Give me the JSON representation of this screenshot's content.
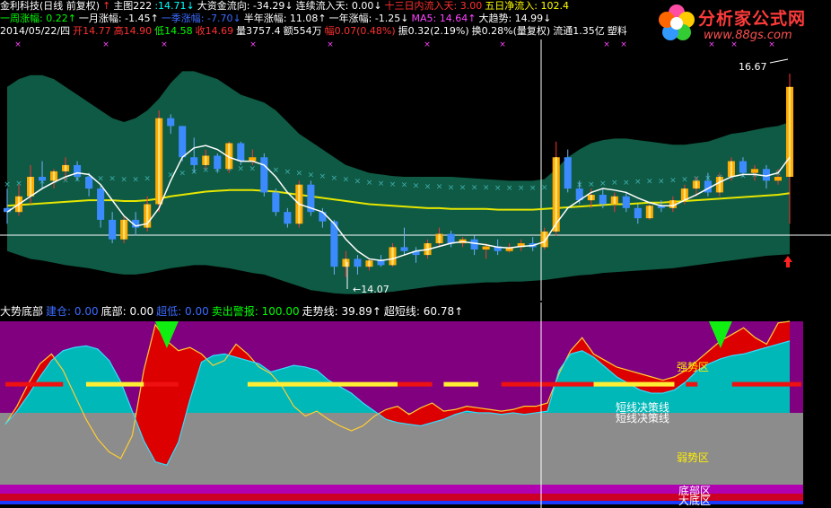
{
  "header": {
    "row1": [
      {
        "text": "金利科技(日线 前复权)",
        "color": "#ffffff"
      },
      {
        "text": "↑",
        "color": "#ff3030"
      },
      {
        "text": "主图222",
        "color": "#ffffff"
      },
      {
        "text": ":14.71↓",
        "color": "#00ffff"
      },
      {
        "text": "大资金流向: -34.29↓",
        "color": "#ffffff"
      },
      {
        "text": "连续流入天: 0.00↓",
        "color": "#ffffff"
      },
      {
        "text": "十三日内流入天: 3.00",
        "color": "#ff3030"
      },
      {
        "text": "五日净流入: 102.4",
        "color": "#ffff00"
      }
    ],
    "row2": [
      {
        "text": "一周涨幅: 0.22↑",
        "color": "#00ff00"
      },
      {
        "text": "一月涨幅: -1.45↑",
        "color": "#ffffff"
      },
      {
        "text": "一季涨幅: -7.70↓",
        "color": "#3b6bff"
      },
      {
        "text": "半年涨幅: 11.08↑",
        "color": "#ffffff"
      },
      {
        "text": "一年涨幅: -1.25↓",
        "color": "#ffffff"
      },
      {
        "text": "MA5: 14.64↑",
        "color": "#ff44ff"
      },
      {
        "text": "大趋势: 14.99↓",
        "color": "#ffffff"
      }
    ],
    "row3": [
      {
        "text": "2014/05/22/四",
        "color": "#ffffff"
      },
      {
        "text": "开14.77",
        "color": "#ff3030"
      },
      {
        "text": "高14.90",
        "color": "#ff3030"
      },
      {
        "text": "低14.58",
        "color": "#00ff00"
      },
      {
        "text": "收14.69",
        "color": "#ff3030"
      },
      {
        "text": "量3757.4",
        "color": "#ffffff"
      },
      {
        "text": "额554万",
        "color": "#ffffff"
      },
      {
        "text": "幅0.07(0.48%)",
        "color": "#ff3030"
      },
      {
        "text": "振0.32(2.19%)",
        "color": "#ffffff"
      },
      {
        "text": "换0.28%(量复权)",
        "color": "#ffffff"
      },
      {
        "text": "流通1.35亿",
        "color": "#ffffff"
      },
      {
        "text": "塑料",
        "color": "#ffffff"
      }
    ]
  },
  "logo": {
    "title": "分析家公式网",
    "url": "www.88gs.com"
  },
  "lower_header": [
    {
      "text": "大势底部",
      "color": "#ffffff"
    },
    {
      "text": "建仓: 0.00",
      "color": "#3b6bff"
    },
    {
      "text": "底部: 0.00",
      "color": "#ffffff"
    },
    {
      "text": "超低: 0.00",
      "color": "#3b6bff"
    },
    {
      "text": "卖出警报: 100.00",
      "color": "#00ff00"
    },
    {
      "text": "走势线: 39.89↑",
      "color": "#ffffff"
    },
    {
      "text": "超短线: 60.78↑",
      "color": "#ffffff"
    }
  ],
  "colors": {
    "band": "#0f5a44",
    "up": "#ffaa00",
    "down": "#3b8bff",
    "ma_white": "#ffffff",
    "ma_yellow": "#e6e600",
    "marker": "#3fb0b0",
    "purple": "#800080",
    "cyan": "#00b8b8",
    "gray": "#8c8c8c",
    "red": "#dd0000"
  },
  "chart_data": [
    {
      "type": "candlestick",
      "price_labels": {
        "high_label": "16.67",
        "low_label": "14.07"
      },
      "ylim": [
        13.8,
        16.9
      ],
      "candles": [
        {
          "o": 14.95,
          "h": 15.2,
          "l": 14.75,
          "c": 14.9
        },
        {
          "o": 14.9,
          "h": 15.25,
          "l": 14.85,
          "c": 15.1
        },
        {
          "o": 15.1,
          "h": 15.5,
          "l": 15.0,
          "c": 15.35
        },
        {
          "o": 15.35,
          "h": 15.55,
          "l": 15.2,
          "c": 15.3
        },
        {
          "o": 15.3,
          "h": 15.45,
          "l": 15.2,
          "c": 15.42
        },
        {
          "o": 15.42,
          "h": 15.6,
          "l": 15.3,
          "c": 15.5
        },
        {
          "o": 15.5,
          "h": 15.55,
          "l": 15.3,
          "c": 15.35
        },
        {
          "o": 15.35,
          "h": 15.4,
          "l": 15.1,
          "c": 15.2
        },
        {
          "o": 15.2,
          "h": 15.25,
          "l": 14.7,
          "c": 14.8
        },
        {
          "o": 14.8,
          "h": 14.9,
          "l": 14.5,
          "c": 14.55
        },
        {
          "o": 14.55,
          "h": 14.85,
          "l": 14.5,
          "c": 14.8
        },
        {
          "o": 14.8,
          "h": 14.9,
          "l": 14.6,
          "c": 14.7
        },
        {
          "o": 14.7,
          "h": 15.1,
          "l": 14.65,
          "c": 15.0
        },
        {
          "o": 15.0,
          "h": 16.2,
          "l": 14.9,
          "c": 16.1
        },
        {
          "o": 16.1,
          "h": 16.15,
          "l": 15.9,
          "c": 16.0
        },
        {
          "o": 16.0,
          "h": 16.0,
          "l": 15.55,
          "c": 15.6
        },
        {
          "o": 15.6,
          "h": 15.85,
          "l": 15.4,
          "c": 15.5
        },
        {
          "o": 15.5,
          "h": 15.7,
          "l": 15.45,
          "c": 15.62
        },
        {
          "o": 15.62,
          "h": 15.65,
          "l": 15.4,
          "c": 15.45
        },
        {
          "o": 15.45,
          "h": 15.8,
          "l": 15.4,
          "c": 15.78
        },
        {
          "o": 15.78,
          "h": 15.8,
          "l": 15.5,
          "c": 15.55
        },
        {
          "o": 15.55,
          "h": 15.7,
          "l": 15.5,
          "c": 15.6
        },
        {
          "o": 15.6,
          "h": 15.65,
          "l": 15.1,
          "c": 15.15
        },
        {
          "o": 15.15,
          "h": 15.2,
          "l": 14.85,
          "c": 14.9
        },
        {
          "o": 14.9,
          "h": 14.95,
          "l": 14.7,
          "c": 14.75
        },
        {
          "o": 14.75,
          "h": 15.3,
          "l": 14.7,
          "c": 15.25
        },
        {
          "o": 15.25,
          "h": 15.3,
          "l": 14.85,
          "c": 14.9
        },
        {
          "o": 14.9,
          "h": 14.95,
          "l": 14.7,
          "c": 14.78
        },
        {
          "o": 14.78,
          "h": 14.8,
          "l": 14.1,
          "c": 14.2
        },
        {
          "o": 14.2,
          "h": 14.4,
          "l": 14.07,
          "c": 14.3
        },
        {
          "o": 14.3,
          "h": 14.35,
          "l": 14.1,
          "c": 14.2
        },
        {
          "o": 14.2,
          "h": 14.3,
          "l": 14.15,
          "c": 14.28
        },
        {
          "o": 14.28,
          "h": 14.35,
          "l": 14.2,
          "c": 14.22
        },
        {
          "o": 14.22,
          "h": 14.5,
          "l": 14.2,
          "c": 14.45
        },
        {
          "o": 14.45,
          "h": 14.7,
          "l": 14.35,
          "c": 14.4
        },
        {
          "o": 14.4,
          "h": 14.45,
          "l": 14.25,
          "c": 14.35
        },
        {
          "o": 14.35,
          "h": 14.55,
          "l": 14.3,
          "c": 14.5
        },
        {
          "o": 14.5,
          "h": 14.7,
          "l": 14.45,
          "c": 14.62
        },
        {
          "o": 14.62,
          "h": 14.66,
          "l": 14.45,
          "c": 14.5
        },
        {
          "o": 14.5,
          "h": 14.58,
          "l": 14.45,
          "c": 14.55
        },
        {
          "o": 14.55,
          "h": 14.6,
          "l": 14.35,
          "c": 14.42
        },
        {
          "o": 14.42,
          "h": 14.5,
          "l": 14.3,
          "c": 14.46
        },
        {
          "o": 14.46,
          "h": 14.55,
          "l": 14.35,
          "c": 14.4
        },
        {
          "o": 14.4,
          "h": 14.5,
          "l": 14.38,
          "c": 14.45
        },
        {
          "o": 14.45,
          "h": 14.55,
          "l": 14.4,
          "c": 14.5
        },
        {
          "o": 14.5,
          "h": 14.58,
          "l": 14.4,
          "c": 14.45
        },
        {
          "o": 14.45,
          "h": 14.7,
          "l": 14.42,
          "c": 14.65
        },
        {
          "o": 14.65,
          "h": 15.8,
          "l": 14.6,
          "c": 15.6
        },
        {
          "o": 15.6,
          "h": 15.7,
          "l": 15.15,
          "c": 15.2
        },
        {
          "o": 15.2,
          "h": 15.3,
          "l": 15.0,
          "c": 15.05
        },
        {
          "o": 15.05,
          "h": 15.2,
          "l": 14.95,
          "c": 15.12
        },
        {
          "o": 15.12,
          "h": 15.2,
          "l": 14.95,
          "c": 15.0
        },
        {
          "o": 15.0,
          "h": 15.15,
          "l": 14.9,
          "c": 15.1
        },
        {
          "o": 15.1,
          "h": 15.15,
          "l": 14.9,
          "c": 14.95
        },
        {
          "o": 14.95,
          "h": 15.0,
          "l": 14.75,
          "c": 14.82
        },
        {
          "o": 14.82,
          "h": 15.0,
          "l": 14.8,
          "c": 14.98
        },
        {
          "o": 14.98,
          "h": 15.05,
          "l": 14.9,
          "c": 14.95
        },
        {
          "o": 14.95,
          "h": 15.1,
          "l": 14.9,
          "c": 15.05
        },
        {
          "o": 15.05,
          "h": 15.25,
          "l": 15.0,
          "c": 15.2
        },
        {
          "o": 15.2,
          "h": 15.35,
          "l": 15.1,
          "c": 15.3
        },
        {
          "o": 15.3,
          "h": 15.4,
          "l": 15.1,
          "c": 15.15
        },
        {
          "o": 15.15,
          "h": 15.4,
          "l": 15.1,
          "c": 15.35
        },
        {
          "o": 15.35,
          "h": 15.6,
          "l": 15.3,
          "c": 15.55
        },
        {
          "o": 15.55,
          "h": 15.6,
          "l": 15.35,
          "c": 15.4
        },
        {
          "o": 15.4,
          "h": 15.5,
          "l": 15.3,
          "c": 15.45
        },
        {
          "o": 15.45,
          "h": 15.5,
          "l": 15.2,
          "c": 15.3
        },
        {
          "o": 15.3,
          "h": 15.45,
          "l": 15.25,
          "c": 15.35
        },
        {
          "o": 15.35,
          "h": 16.67,
          "l": 14.75,
          "c": 16.5
        }
      ],
      "ma_white": [
        14.9,
        15.0,
        15.1,
        15.2,
        15.28,
        15.35,
        15.4,
        15.38,
        15.25,
        15.05,
        14.85,
        14.72,
        14.75,
        14.95,
        15.3,
        15.6,
        15.72,
        15.75,
        15.7,
        15.6,
        15.55,
        15.55,
        15.5,
        15.35,
        15.15,
        15.0,
        14.95,
        14.9,
        14.75,
        14.55,
        14.4,
        14.3,
        14.28,
        14.3,
        14.35,
        14.4,
        14.42,
        14.46,
        14.5,
        14.52,
        14.5,
        14.48,
        14.45,
        14.44,
        14.46,
        14.47,
        14.52,
        14.75,
        14.95,
        15.05,
        15.15,
        15.2,
        15.18,
        15.15,
        15.08,
        15.02,
        14.98,
        14.98,
        15.05,
        15.12,
        15.2,
        15.28,
        15.35,
        15.38,
        15.38,
        15.36,
        15.4,
        15.6
      ],
      "ma_yellow": [
        14.98,
        14.99,
        15.0,
        15.01,
        15.02,
        15.03,
        15.04,
        15.05,
        15.05,
        15.05,
        15.04,
        15.04,
        15.05,
        15.07,
        15.1,
        15.12,
        15.14,
        15.16,
        15.17,
        15.18,
        15.18,
        15.18,
        15.17,
        15.16,
        15.14,
        15.12,
        15.1,
        15.08,
        15.06,
        15.04,
        15.02,
        15.0,
        14.99,
        14.98,
        14.97,
        14.96,
        14.95,
        14.95,
        14.94,
        14.94,
        14.94,
        14.94,
        14.93,
        14.93,
        14.93,
        14.93,
        14.94,
        14.95,
        14.96,
        14.97,
        14.98,
        14.99,
        15.0,
        15.0,
        15.01,
        15.02,
        15.02,
        15.03,
        15.04,
        15.05,
        15.06,
        15.07,
        15.08,
        15.09,
        15.1,
        15.11,
        15.12,
        15.14
      ],
      "band_upper": [
        16.5,
        16.6,
        16.65,
        16.65,
        16.6,
        16.5,
        16.4,
        16.3,
        16.2,
        16.1,
        16.05,
        16.1,
        16.2,
        16.35,
        16.55,
        16.7,
        16.7,
        16.65,
        16.6,
        16.5,
        16.4,
        16.35,
        16.3,
        16.2,
        16.05,
        15.9,
        15.8,
        15.7,
        15.6,
        15.5,
        15.45,
        15.4,
        15.38,
        15.36,
        15.35,
        15.35,
        15.35,
        15.35,
        15.35,
        15.34,
        15.33,
        15.32,
        15.31,
        15.3,
        15.3,
        15.3,
        15.32,
        15.45,
        15.6,
        15.7,
        15.78,
        15.82,
        15.84,
        15.84,
        15.82,
        15.8,
        15.78,
        15.76,
        15.76,
        15.78,
        15.8,
        15.85,
        15.9,
        15.92,
        15.95,
        15.98,
        16.0,
        16.05
      ],
      "band_lower": [
        14.4,
        14.35,
        14.3,
        14.28,
        14.25,
        14.22,
        14.2,
        14.18,
        14.15,
        14.12,
        14.1,
        14.1,
        14.12,
        14.15,
        14.18,
        14.2,
        14.22,
        14.22,
        14.2,
        14.18,
        14.15,
        14.12,
        14.1,
        14.05,
        14.0,
        13.95,
        13.9,
        13.88,
        13.86,
        13.85,
        13.85,
        13.86,
        13.87,
        13.88,
        13.9,
        13.92,
        13.94,
        13.96,
        13.97,
        13.98,
        13.99,
        14.0,
        14.0,
        14.01,
        14.01,
        14.02,
        14.03,
        14.05,
        14.07,
        14.09,
        14.1,
        14.12,
        14.13,
        14.14,
        14.15,
        14.16,
        14.17,
        14.18,
        14.2,
        14.22,
        14.24,
        14.26,
        14.28,
        14.3,
        14.32,
        14.34,
        14.35,
        14.36
      ]
    },
    {
      "type": "area",
      "title": "大势底部",
      "ylim": [
        0,
        100
      ],
      "zone_labels": {
        "strong": "强势区",
        "short": "短线决策线",
        "weak": "弱势区",
        "bottom": "底部区",
        "big_bottom": "大底区"
      },
      "cyan_area": [
        37,
        45,
        55,
        66,
        76,
        82,
        84,
        85,
        83,
        76,
        63,
        45,
        27,
        14,
        12,
        26,
        52,
        75,
        79,
        80,
        78,
        76,
        74,
        69,
        71,
        73,
        72,
        70,
        64,
        60,
        56,
        50,
        45,
        40,
        38,
        37,
        36,
        38,
        40,
        43,
        45,
        44,
        44,
        43,
        44,
        43,
        44,
        45,
        70,
        80,
        82,
        78,
        72,
        66,
        62,
        58,
        56,
        56,
        58,
        63,
        70,
        74,
        77,
        79,
        80,
        82,
        84,
        86,
        88
      ],
      "red_line": [
        37,
        48,
        62,
        74,
        80,
        70,
        55,
        40,
        28,
        20,
        16,
        30,
        70,
        98,
        88,
        82,
        84,
        80,
        73,
        76,
        86,
        80,
        72,
        68,
        60,
        48,
        42,
        45,
        40,
        36,
        33,
        36,
        42,
        46,
        48,
        43,
        47,
        50,
        45,
        46,
        48,
        47,
        46,
        45,
        46,
        48,
        48,
        50,
        68,
        82,
        90,
        80,
        76,
        72,
        70,
        68,
        66,
        64,
        66,
        70,
        76,
        82,
        88,
        92,
        96,
        90,
        86,
        99,
        100
      ],
      "red_segments": [
        {
          "from": 0,
          "to": 5,
          "level": 62
        },
        {
          "from": 12,
          "to": 15,
          "level": 62
        },
        {
          "from": 34,
          "to": 37,
          "level": 62
        },
        {
          "from": 43,
          "to": 51,
          "level": 62
        },
        {
          "from": 59,
          "to": 60,
          "level": 62
        },
        {
          "from": 63,
          "to": 69,
          "level": 62
        }
      ],
      "yellow_segments": [
        {
          "from": 7,
          "to": 12,
          "level": 62
        },
        {
          "from": 21,
          "to": 34,
          "level": 62
        },
        {
          "from": 38,
          "to": 41,
          "level": 62
        },
        {
          "from": 51,
          "to": 58,
          "level": 62
        }
      ],
      "sell_signals": [
        14,
        62
      ]
    }
  ]
}
